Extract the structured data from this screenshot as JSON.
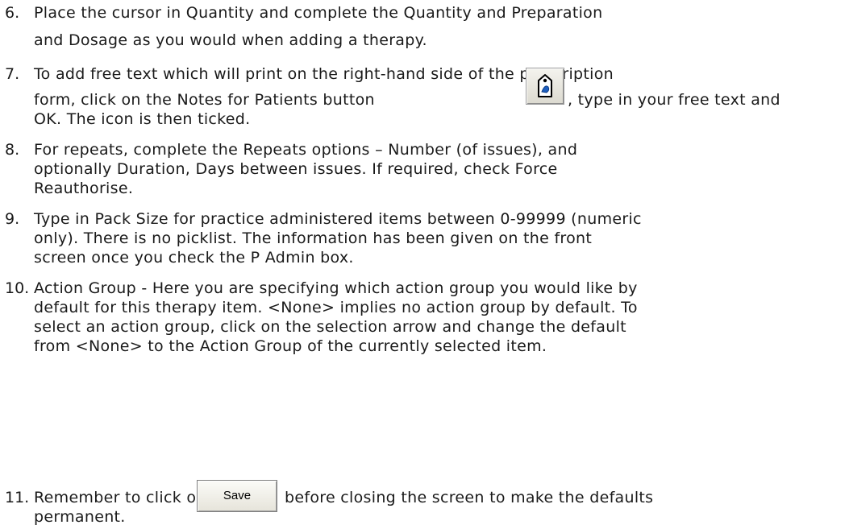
{
  "steps": [
    {
      "number": "6.",
      "lines": [
        "Place the cursor in Quantity and complete the Quantity and Preparation",
        "and Dosage as you would when adding a therapy."
      ]
    },
    {
      "number": "7.",
      "line1": "To add free text which will print on the right-hand side of the prescription",
      "line2_before": "form, click on the Notes for Patients button",
      "line2_after": ", type in your free text and",
      "line3": "OK.  The icon is then ticked.",
      "button_icon": "notes-for-patients-icon"
    },
    {
      "number": "8.",
      "lines": [
        "For repeats, complete the Repeats options – Number (of issues), and",
        "optionally Duration, Days between issues.  If required, check Force",
        "Reauthorise."
      ]
    },
    {
      "number": "9.",
      "lines": [
        "Type in Pack Size for practice administered items between 0-99999 (numeric",
        "only).  There is no picklist.  The information has been given on the front",
        "screen once you check the P Admin box."
      ]
    },
    {
      "number": "10.",
      "lines": [
        "Action Group - Here you are specifying which action group you would like by",
        "default for this therapy item.   <None> implies no action group by default.  To",
        "select an action group, click on the selection arrow and change the default",
        "from <None> to the Action Group of the currently selected item."
      ]
    },
    {
      "number": "11.",
      "line1_before": "Remember to click on",
      "line1_after": "before closing the screen to make the defaults",
      "line2": "permanent.",
      "button_label": "Save"
    }
  ],
  "colors": {
    "text": "#1a1a1a",
    "icon_accent": "#1f5fbf"
  }
}
